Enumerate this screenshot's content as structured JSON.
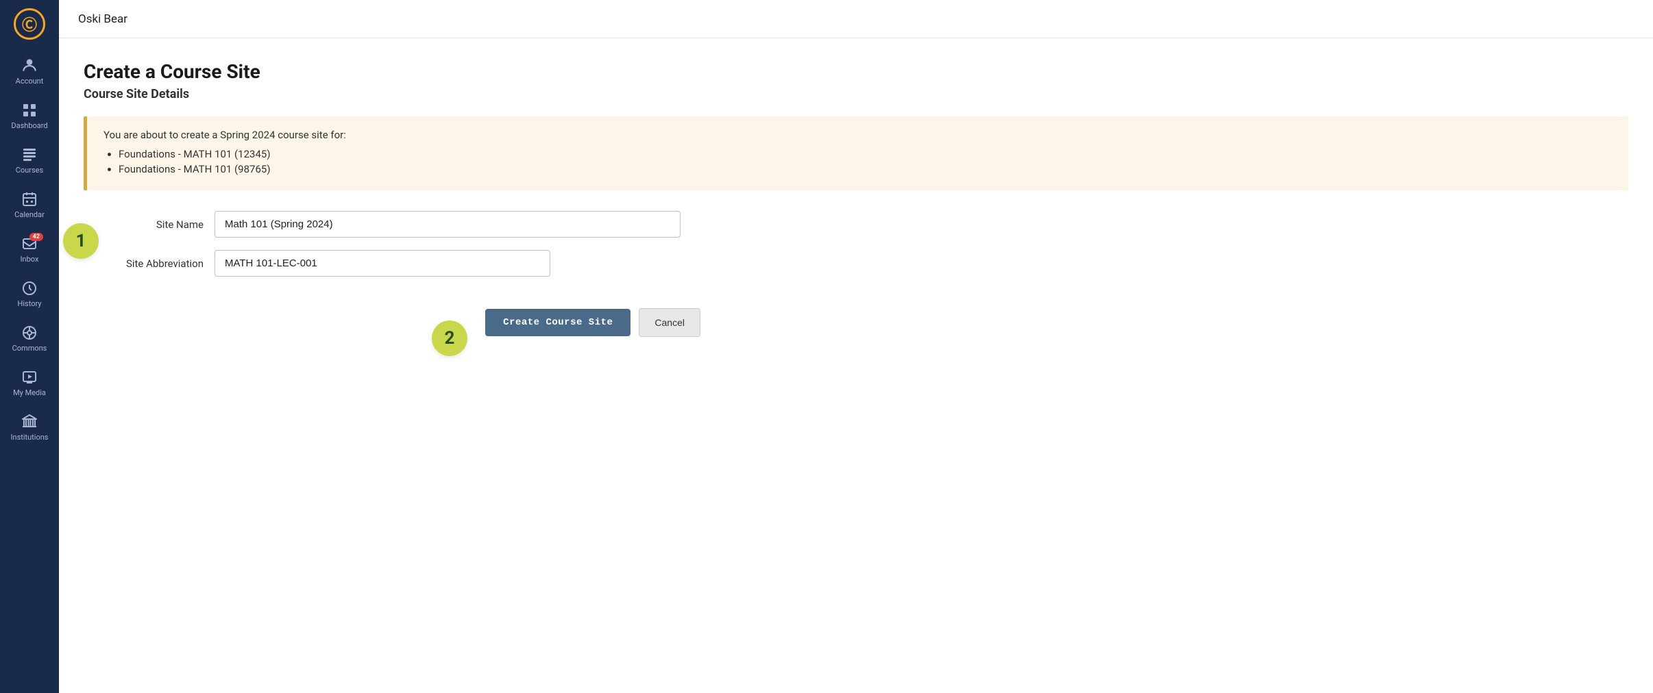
{
  "app": {
    "logo_text": "C",
    "top_bar_user": "Oski Bear"
  },
  "sidebar": {
    "items": [
      {
        "id": "account",
        "label": "Account",
        "icon": "👤"
      },
      {
        "id": "dashboard",
        "label": "Dashboard",
        "icon": "⊞"
      },
      {
        "id": "courses",
        "label": "Courses",
        "icon": "📋"
      },
      {
        "id": "calendar",
        "label": "Calendar",
        "icon": "📅"
      },
      {
        "id": "inbox",
        "label": "Inbox",
        "icon": "📨",
        "badge": "42"
      },
      {
        "id": "history",
        "label": "History",
        "icon": "🕐"
      },
      {
        "id": "commons",
        "label": "Commons",
        "icon": "➡"
      },
      {
        "id": "my-media",
        "label": "My Media",
        "icon": "🎬"
      },
      {
        "id": "institutions",
        "label": "Institutions",
        "icon": "🏛"
      }
    ]
  },
  "page": {
    "title": "Create a Course Site",
    "subtitle": "Course Site Details",
    "info_intro": "You are about to create a Spring 2024 course site for:",
    "info_courses": [
      "Foundations - MATH 101 (12345)",
      "Foundations - MATH 101 (98765)"
    ],
    "step1_label": "1",
    "step2_label": "2",
    "form": {
      "site_name_label": "Site Name",
      "site_name_value": "Math 101 (Spring 2024)",
      "site_name_placeholder": "",
      "site_abbr_label": "Site Abbreviation",
      "site_abbr_value": "MATH 101-LEC-001",
      "site_abbr_placeholder": ""
    },
    "buttons": {
      "create": "Create Course Site",
      "cancel": "Cancel"
    }
  }
}
